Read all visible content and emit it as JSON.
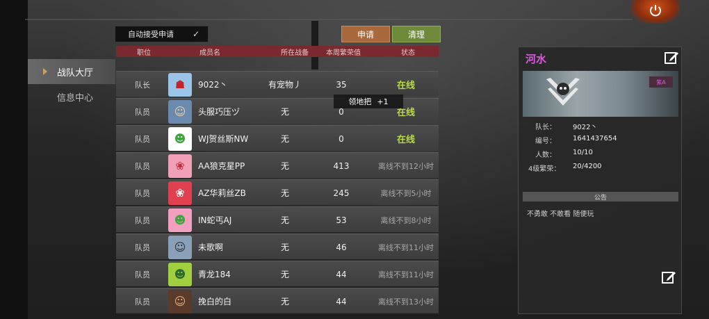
{
  "sidebar": {
    "items": [
      {
        "label": "战队大厅",
        "active": true
      },
      {
        "label": "信息中心",
        "active": false
      }
    ]
  },
  "toolbar": {
    "auto_accept_label": "自动接受申请",
    "auto_accept_checked": true,
    "apply_label": "申请",
    "clean_label": "清理"
  },
  "table": {
    "headers": [
      "职位",
      "成员名",
      "所在战备",
      "本周繁荣值",
      "状态"
    ],
    "rows": [
      {
        "role": "队长",
        "avatar": "red-mask",
        "name": "9022丶",
        "base": "有宠物丿",
        "score": "35",
        "state": "在线",
        "online": true
      },
      {
        "role": "队员",
        "avatar": "warrior",
        "name": "头服巧压ヅ",
        "base": "无",
        "score": "0",
        "state": "在线",
        "online": true
      },
      {
        "role": "队员",
        "avatar": "frog",
        "name": "WJ贺丝斯NW",
        "base": "无",
        "score": "0",
        "state": "在线",
        "online": true
      },
      {
        "role": "队员",
        "avatar": "pink-bear",
        "name": "AA狼克星PP",
        "base": "无",
        "score": "413",
        "state": "离线不到12小时",
        "online": false
      },
      {
        "role": "队员",
        "avatar": "red-bear",
        "name": "AZ华莉丝ZB",
        "base": "无",
        "score": "245",
        "state": "离线不到5小时",
        "online": false
      },
      {
        "role": "队员",
        "avatar": "frog-pink",
        "name": "IN蛇丐AJ",
        "base": "无",
        "score": "53",
        "state": "离线不到8小时",
        "online": false
      },
      {
        "role": "队员",
        "avatar": "soldier",
        "name": "未歌啊",
        "base": "无",
        "score": "46",
        "state": "离线不到11小时",
        "online": false
      },
      {
        "role": "队员",
        "avatar": "frog-green",
        "name": "青龙184",
        "base": "无",
        "score": "44",
        "state": "离线不到11小时",
        "online": false
      },
      {
        "role": "队员",
        "avatar": "hat-girl",
        "name": "挽白的白",
        "base": "无",
        "score": "44",
        "state": "离线不到13小时",
        "online": false
      }
    ]
  },
  "tooltip": {
    "label": "领地把",
    "value": "+1"
  },
  "panel": {
    "team_name": "河水",
    "badge": "紫A",
    "info": [
      {
        "key": "队长：",
        "value": "9022丶"
      },
      {
        "key": "编号：",
        "value": "1641437654"
      },
      {
        "key": "人数：",
        "value": "10/10"
      },
      {
        "key": "4级繁荣：",
        "value": "20/4200"
      }
    ],
    "notice_title": "公告",
    "notice_text": "不勇敢 不敢看 随便玩"
  },
  "colors": {
    "online": "#b9d94a",
    "offline": "#a8a8a8",
    "header": "#7a2a2e",
    "apply": "#a86a3c",
    "clean": "#6e8a3a",
    "team_name": "#d85bd9"
  }
}
